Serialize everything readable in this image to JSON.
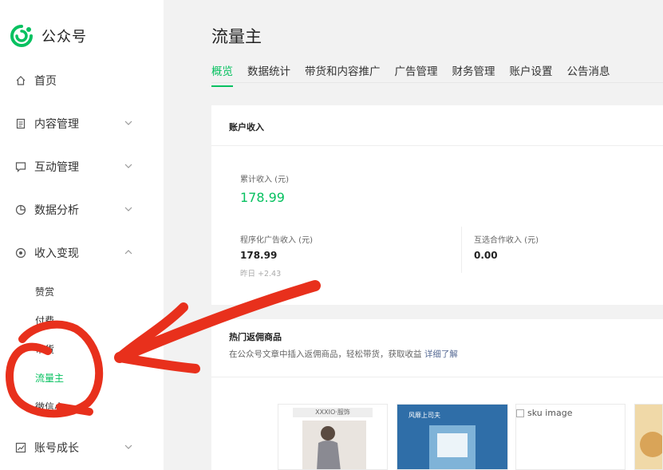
{
  "app": {
    "name": "公众号"
  },
  "sidebar": {
    "items": [
      {
        "label": "首页",
        "icon": "home-icon",
        "expandable": false
      },
      {
        "label": "内容管理",
        "icon": "document-icon",
        "expandable": true,
        "expanded": false
      },
      {
        "label": "互动管理",
        "icon": "chat-icon",
        "expandable": true,
        "expanded": false
      },
      {
        "label": "数据分析",
        "icon": "pie-chart-icon",
        "expandable": true,
        "expanded": false
      },
      {
        "label": "收入变现",
        "icon": "coin-icon",
        "expandable": true,
        "expanded": true
      },
      {
        "label": "账号成长",
        "icon": "growth-chart-icon",
        "expandable": true,
        "expanded": false
      }
    ],
    "sub_items": [
      {
        "label": "赞赏",
        "active": false
      },
      {
        "label": "付费",
        "active": false
      },
      {
        "label": "带货",
        "active": false
      },
      {
        "label": "流量主",
        "active": true
      },
      {
        "label": "微信小",
        "active": false
      }
    ]
  },
  "main": {
    "title": "流量主",
    "tabs": [
      {
        "label": "概览",
        "active": true
      },
      {
        "label": "数据统计",
        "active": false
      },
      {
        "label": "带货和内容推广",
        "active": false
      },
      {
        "label": "广告管理",
        "active": false
      },
      {
        "label": "财务管理",
        "active": false
      },
      {
        "label": "账户设置",
        "active": false
      },
      {
        "label": "公告消息",
        "active": false
      }
    ],
    "income": {
      "title": "账户收入",
      "total_label": "累计收入 (元)",
      "total_value": "178.99",
      "program_label": "程序化广告收入 (元)",
      "program_value": "178.99",
      "program_delta": "昨日 +2.43",
      "mutual_label": "互选合作收入 (元)",
      "mutual_value": "0.00"
    },
    "hot": {
      "title": "热门返佣商品",
      "desc": "在公众号文章中插入返佣商品，轻松带货，获取收益",
      "link": "详细了解",
      "sku_alt": "sku image",
      "product2_text": "风靡上司夫",
      "product1_text": "XXXIO·服饰"
    }
  },
  "colors": {
    "accent": "#07c160",
    "link": "#576b95",
    "annotation": "#e8301c"
  }
}
